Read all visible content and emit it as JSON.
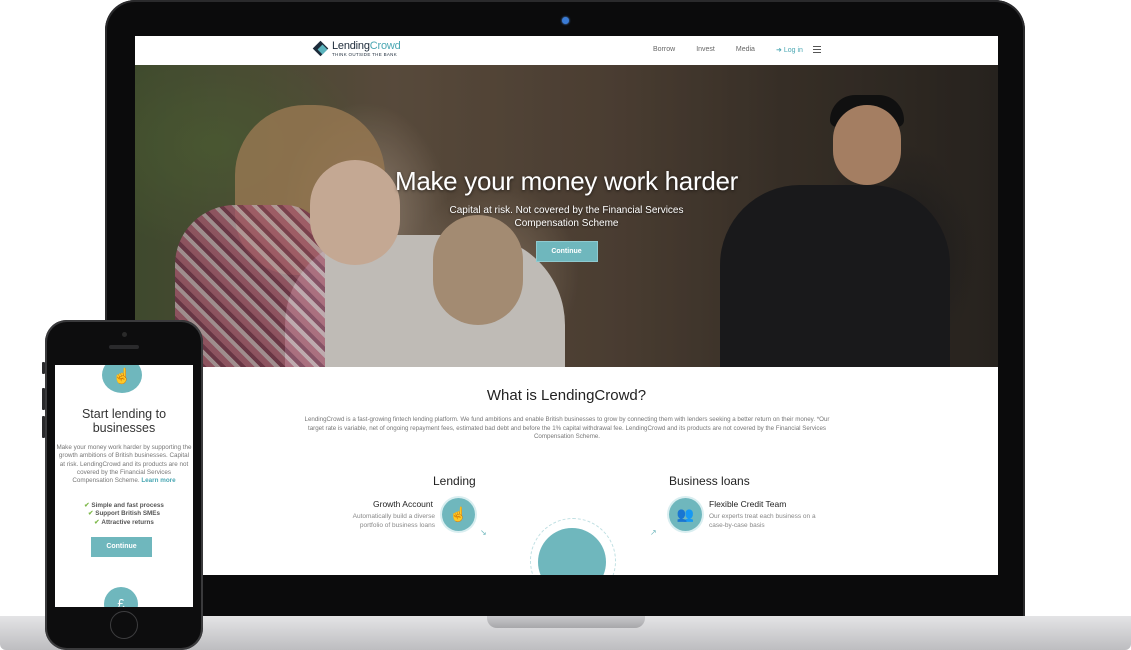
{
  "nav": {
    "brand_main": "Lending",
    "brand_accent": "Crowd",
    "tagline": "THINK OUTSIDE THE BANK",
    "links": [
      "Borrow",
      "Invest",
      "Media"
    ],
    "login": "Log in",
    "menu_icon": "hamburger-icon"
  },
  "hero": {
    "title": "Make your money work harder",
    "subtitle": "Capital at risk. Not covered by the Financial Services Compensation Scheme",
    "button": "Continue"
  },
  "about": {
    "title": "What is LendingCrowd?",
    "text": "LendingCrowd is a fast-growing fintech lending platform. We fund ambitions and enable British businesses to grow by connecting them with lenders seeking a better return on their money.  *Our target rate is variable, net of ongoing repayment fees, estimated bad debt and before the 1% capital withdrawal fee. LendingCrowd and its products are not covered by the Financial Services Compensation Scheme."
  },
  "lending": {
    "heading": "Lending",
    "feature_title": "Growth Account",
    "feature_desc": "Automatically build a diverse portfolio of business loans",
    "icon": "handshake-icon"
  },
  "business": {
    "heading": "Business loans",
    "feature_title": "Flexible Credit Team",
    "feature_desc": "Our experts treat each business on a case-by-case basis",
    "icon": "team-icon"
  },
  "mobile": {
    "title": "Start lending to businesses",
    "text": "Make your money work harder by supporting the growth ambitions of British businesses. Capital at risk. LendingCrowd and its products are not covered by the Financial Services Compensation Scheme.",
    "link": "Learn more",
    "checks": [
      "Simple and fast process",
      "Support British SMEs",
      "Attractive returns"
    ],
    "button": "Continue"
  },
  "colors": {
    "accent": "#6fb7bd",
    "brand_dark": "#1d2b3a",
    "check": "#7fb94c"
  }
}
